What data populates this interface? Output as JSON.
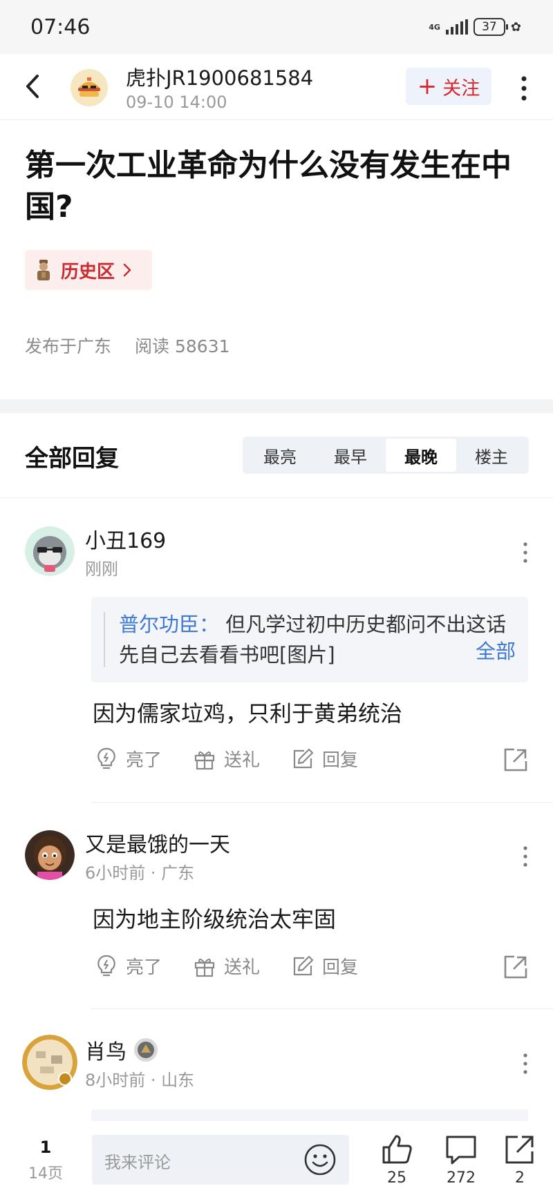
{
  "status_bar": {
    "time": "07:46",
    "network": "4G",
    "battery": "37"
  },
  "header": {
    "author": "虎扑JR1900681584",
    "date": "09-10 14:00",
    "follow_label": "关注",
    "follow_plus": "+"
  },
  "post": {
    "title": "第一次工业革命为什么没有发生在中国?",
    "forum": "历史区",
    "location": "发布于广东",
    "reads_label": "阅读",
    "reads": "58631"
  },
  "replies_section": {
    "title": "全部回复",
    "sort_tabs": [
      "最亮",
      "最早",
      "最晚",
      "楼主"
    ],
    "active_tab": "最晚"
  },
  "replies": [
    {
      "user": "小丑169",
      "time": "刚刚",
      "quote": {
        "user": "普尔功臣：",
        "text": "但凡学过初中历史都问不出这话 先自己去看看书吧[图片]",
        "more": "全部"
      },
      "content": "因为儒家垃鸡，只利于黄弟统治"
    },
    {
      "user": "又是最饿的一天",
      "time": "6小时前 · 广东",
      "content": "因为地主阶级统治太牢固"
    },
    {
      "user": "肖鸟",
      "time": "8小时前 · 山东"
    }
  ],
  "actions": {
    "like": "亮了",
    "gift": "送礼",
    "reply": "回复"
  },
  "bottom_bar": {
    "page_current": "1",
    "page_total": "14页",
    "comment_placeholder": "我来评论",
    "likes": "25",
    "comments": "272",
    "shares": "2"
  },
  "colors": {
    "accent_red": "#d9262f",
    "link_blue": "#3e79d2",
    "tag_bg": "#fdeeee"
  }
}
